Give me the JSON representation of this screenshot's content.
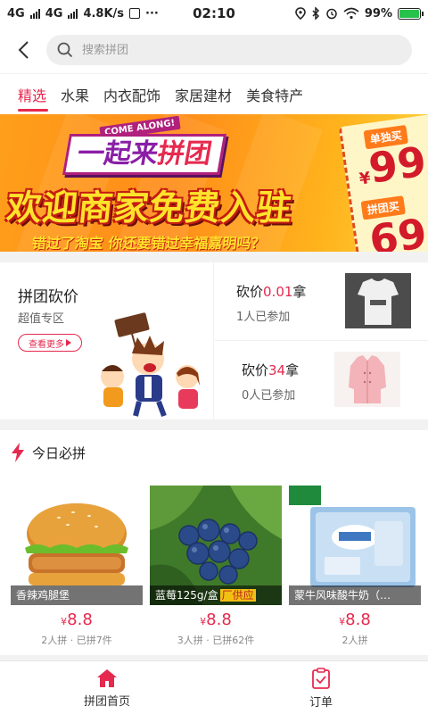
{
  "status_bar": {
    "network1": "4G",
    "network2": "4G",
    "speed": "4.8K/s",
    "extra": "···",
    "time": "02:10",
    "battery": "99%"
  },
  "header": {
    "search_placeholder": "搜索拼团"
  },
  "tabs": [
    "精选",
    "水果",
    "内衣配饰",
    "家居建材",
    "美食特产"
  ],
  "banner": {
    "come_along": "COME ALONG!",
    "title_a": "一起来",
    "title_b": "拼团",
    "main": "欢迎商家免费入驻",
    "sub": "错过了淘宝 你还要错过幸福嘉明吗？",
    "ticket_label1": "单独买",
    "ticket_price1": "99",
    "ticket_currency": "¥",
    "ticket_label2": "拼团买",
    "ticket_price2": "69"
  },
  "bargain": {
    "title": "拼团砍价",
    "subtitle": "超值专区",
    "more": "查看更多",
    "items": [
      {
        "prefix": "砍价",
        "highlight": "0.01",
        "suffix": "拿",
        "count": "1人已参加"
      },
      {
        "prefix": "砍价",
        "highlight": "34",
        "suffix": "拿",
        "count": "0人已参加"
      }
    ]
  },
  "today": {
    "title": "今日必拼",
    "products": [
      {
        "name": "香辣鸡腿堡",
        "currency": "¥",
        "price": "8.8",
        "meta": "2人拼 · 已拼7件"
      },
      {
        "name": "蓝莓125g/盒",
        "tag": "厂供应",
        "currency": "¥",
        "price": "8.8",
        "meta": "3人拼 · 已拼62件"
      },
      {
        "name": "蒙牛风味酸牛奶（…",
        "currency": "¥",
        "price": "8.8",
        "meta": "2人拼"
      }
    ]
  },
  "bottom_nav": {
    "home": "拼团首页",
    "orders": "订单"
  },
  "colors": {
    "accent": "#e6294e",
    "banner_orange": "#ff9f1a",
    "banner_yellow": "#ffe32b"
  }
}
